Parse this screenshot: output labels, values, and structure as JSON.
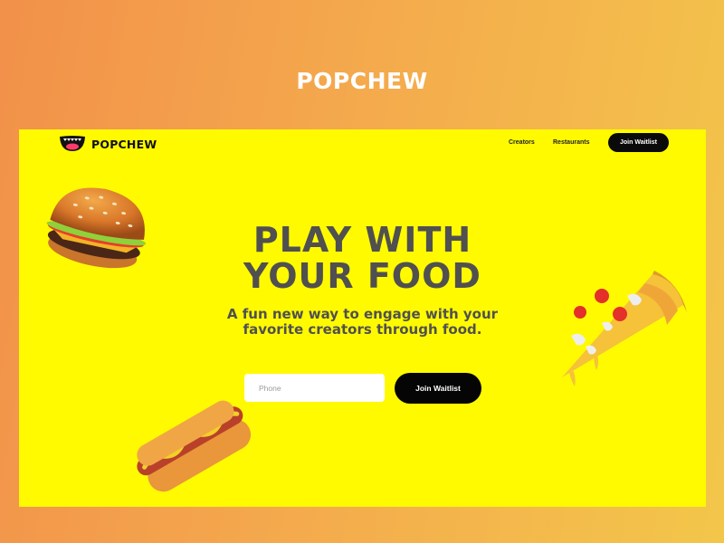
{
  "page": {
    "title": "POPCHEW"
  },
  "nav": {
    "brand": "POPCHEW",
    "links": [
      {
        "label": "Creators"
      },
      {
        "label": "Restaurants"
      }
    ],
    "cta_label": "Join Waitlist"
  },
  "hero": {
    "title_line1": "PLAY WITH",
    "title_line2": "YOUR FOOD",
    "subtitle_line1": "A fun new way to engage with your",
    "subtitle_line2": "favorite creators through food."
  },
  "signup": {
    "phone_placeholder": "Phone",
    "phone_value": "",
    "button_label": "Join Waitlist"
  },
  "icons": {
    "logo": "mouth-logo-icon",
    "burger": "burger-icon",
    "pizza": "pizza-slice-icon",
    "hotdog": "hotdog-icon"
  },
  "colors": {
    "background_start": "#f2914a",
    "background_end": "#f3c64a",
    "frame": "#fffa00",
    "heading": "#505050",
    "button": "#050505"
  }
}
